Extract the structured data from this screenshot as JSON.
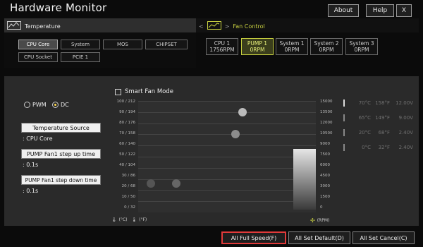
{
  "app": {
    "title": "Hardware Monitor"
  },
  "topbar": {
    "about": "About",
    "help": "Help",
    "close": "X"
  },
  "temperature_panel": {
    "label": "Temperature",
    "buttons": [
      {
        "label": "CPU Core"
      },
      {
        "label": "System"
      },
      {
        "label": "MOS"
      },
      {
        "label": "CHIPSET"
      },
      {
        "label": "CPU Socket"
      },
      {
        "label": "PCIE 1"
      }
    ],
    "selected": "CPU Core"
  },
  "fan_panel": {
    "label": "Fan Control",
    "nav_left": "<",
    "nav_right": ">",
    "fans": [
      {
        "name": "CPU 1",
        "rpm": "1756RPM"
      },
      {
        "name": "PUMP 1",
        "rpm": "0RPM"
      },
      {
        "name": "System 1",
        "rpm": "0RPM"
      },
      {
        "name": "System 2",
        "rpm": "0RPM"
      },
      {
        "name": "System 3",
        "rpm": "0RPM"
      }
    ],
    "selected": "PUMP 1"
  },
  "mode": {
    "pwm": "PWM",
    "dc": "DC",
    "selected": "DC"
  },
  "smart_fan": {
    "label": "Smart Fan Mode",
    "checked": false
  },
  "settings": {
    "temp_source_btn": "Temperature Source",
    "temp_source_val": ": CPU Core",
    "step_up_btn": "PUMP Fan1 step up time",
    "step_up_val": ": 0.1s",
    "step_down_btn": "PUMP Fan1 step down time",
    "step_down_val": ": 0.1s"
  },
  "graph": {
    "y_left": [
      "100 / 212",
      "90 / 194",
      "80 / 176",
      "70 / 158",
      "60 / 140",
      "50 / 122",
      "40 / 104",
      "30 / 86",
      "20 / 68",
      "10 / 50",
      "0 / 32"
    ],
    "y_right": [
      "15000",
      "13500",
      "12000",
      "10500",
      "9000",
      "7500",
      "6000",
      "4500",
      "3000",
      "1500",
      "0"
    ],
    "celsius_unit": "(°C)",
    "fahrenheit_unit": "(°F)",
    "rpm_unit": "(RPM)"
  },
  "readouts": [
    {
      "c": "70°C",
      "f": "158°F",
      "v": "12.00V"
    },
    {
      "c": "65°C",
      "f": "149°F",
      "v": "9.00V"
    },
    {
      "c": "20°C",
      "f": "68°F",
      "v": "2.40V"
    },
    {
      "c": "0°C",
      "f": "32°F",
      "v": "2.40V"
    }
  ],
  "bottom": {
    "full_speed": "All Full Speed(F)",
    "set_default": "All Set Default(D)",
    "set_cancel": "All Set Cancel(C)"
  },
  "colors": {
    "accent": "#c8d040",
    "highlight": "#e03a3a"
  }
}
